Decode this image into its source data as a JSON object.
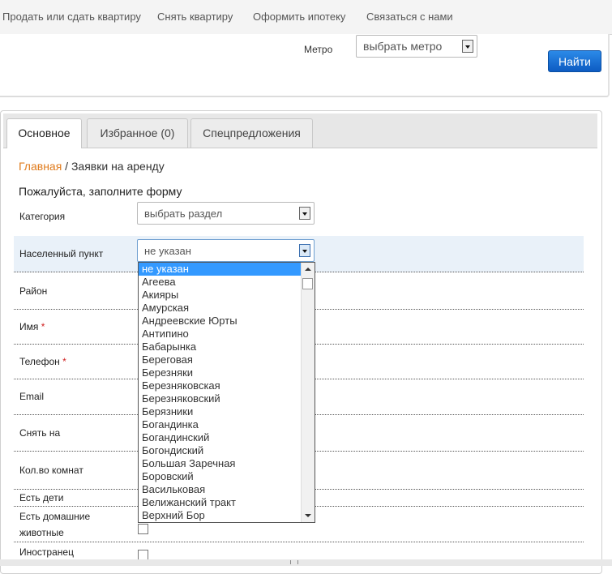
{
  "nav": {
    "items": [
      "Продать или сдать квартиру",
      "Снять квартиру",
      "Оформить ипотеку",
      "Связаться с нами"
    ]
  },
  "search": {
    "metro_label": "Метро",
    "metro_value": "выбрать метро",
    "find_button": "Найти"
  },
  "tabs": [
    "Основное",
    "Избранное (0)",
    "Спецпредложения"
  ],
  "breadcrumb": {
    "home": "Главная",
    "separator": " / ",
    "current": "Заявки на аренду"
  },
  "form": {
    "title": "Пожалуйста, заполните форму",
    "category_label": "Категория",
    "category_value": "выбрать раздел",
    "city_label": "Населенный пункт",
    "city_value": "не указан",
    "district_label": "Район",
    "name_label": "Имя",
    "phone_label": "Телефон",
    "email_label": "Email",
    "rent_for_label": "Снять на",
    "rooms_label": "Кол.во комнат",
    "kids_label": "Есть дети",
    "pets_label_line1": "Есть домашние",
    "pets_label_line2": "животные",
    "foreigner_label": "Иностранец",
    "required_mark": "*"
  },
  "city_dropdown": {
    "options": [
      "не указан",
      "Агеева",
      "Акияры",
      "Амурская",
      "Андреевские Юрты",
      "Антипино",
      "Бабарынка",
      "Береговая",
      "Березняки",
      "Березняковская",
      "Березняковский",
      "Берязники",
      "Богандинка",
      "Богандинский",
      "Богондиский",
      "Большая Заречная",
      "Боровский",
      "Васильковая",
      "Велижанский тракт",
      "Верхний Бор"
    ],
    "selected_index": 0
  },
  "colors": {
    "accent_orange": "#e07b1c",
    "button_blue": "#0d5bc2",
    "selection_blue": "#3399ff",
    "required_red": "#d02020"
  }
}
